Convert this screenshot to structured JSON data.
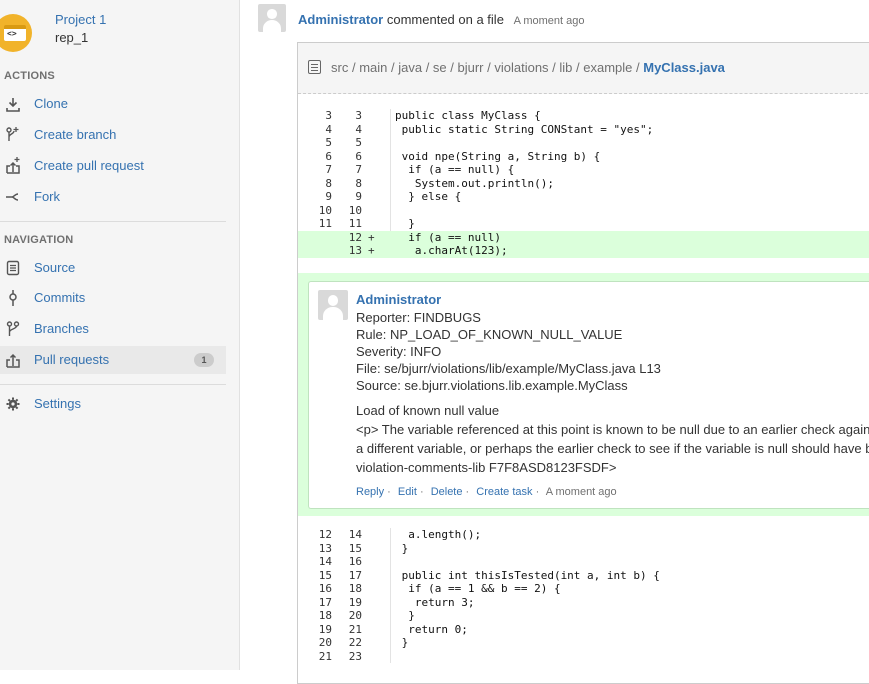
{
  "sidebar": {
    "project_name": "Project 1",
    "repo_name": "rep_1",
    "avatar_code": "<>",
    "actions_title": "ACTIONS",
    "actions": [
      {
        "label": "Clone",
        "icon": "download-icon"
      },
      {
        "label": "Create branch",
        "icon": "branch-add-icon"
      },
      {
        "label": "Create pull request",
        "icon": "pull-request-add-icon"
      },
      {
        "label": "Fork",
        "icon": "fork-icon"
      }
    ],
    "navigation_title": "NAVIGATION",
    "navigation": [
      {
        "label": "Source",
        "icon": "source-icon"
      },
      {
        "label": "Commits",
        "icon": "commit-icon"
      },
      {
        "label": "Branches",
        "icon": "branch-icon"
      },
      {
        "label": "Pull requests",
        "icon": "pull-request-icon",
        "badge": "1"
      }
    ],
    "settings_label": "Settings"
  },
  "activity": {
    "author": "Administrator",
    "text": "commented on a file",
    "time": "A moment ago"
  },
  "file": {
    "path_parts": [
      "src",
      "main",
      "java",
      "se",
      "bjurr",
      "violations",
      "lib",
      "example"
    ],
    "file_name": "MyClass.java"
  },
  "code_top": [
    {
      "n1": "3",
      "n2": "3",
      "mk": "",
      "text": "public class MyClass {"
    },
    {
      "n1": "4",
      "n2": "4",
      "mk": "",
      "text": " public static String CONStant = \"yes\";"
    },
    {
      "n1": "5",
      "n2": "5",
      "mk": "",
      "text": ""
    },
    {
      "n1": "6",
      "n2": "6",
      "mk": "",
      "text": " void npe(String a, String b) {"
    },
    {
      "n1": "7",
      "n2": "7",
      "mk": "",
      "text": "  if (a == null) {"
    },
    {
      "n1": "8",
      "n2": "8",
      "mk": "",
      "text": "   System.out.println();"
    },
    {
      "n1": "9",
      "n2": "9",
      "mk": "",
      "text": "  } else {"
    },
    {
      "n1": "10",
      "n2": "10",
      "mk": "",
      "text": ""
    },
    {
      "n1": "11",
      "n2": "11",
      "mk": "",
      "text": "  }"
    },
    {
      "n1": "",
      "n2": "12",
      "mk": "+",
      "text": "  if (a == null)",
      "added": true
    },
    {
      "n1": "",
      "n2": "13",
      "mk": "+",
      "text": "   a.charAt(123);",
      "added": true
    }
  ],
  "comment": {
    "author": "Administrator",
    "lines": [
      "Reporter: FINDBUGS",
      "Rule: NP_LOAD_OF_KNOWN_NULL_VALUE",
      "Severity: INFO",
      "File: se/bjurr/violations/lib/example/MyClass.java L13",
      "Source: se.bjurr.violations.lib.example.MyClass"
    ],
    "body": [
      "Load of known null value",
      "<p> The variable referenced at this point is known to be null due to an earlier check against n",
      "a different variable, or perhaps the earlier check to see if the variable is null should have bee",
      "violation-comments-lib F7F8ASD8123FSDF>"
    ],
    "actions": [
      "Reply",
      "Edit",
      "Delete",
      "Create task",
      "A moment ago"
    ]
  },
  "code_bottom": [
    {
      "n1": "12",
      "n2": "14",
      "mk": "",
      "text": "  a.length();"
    },
    {
      "n1": "13",
      "n2": "15",
      "mk": "",
      "text": " }"
    },
    {
      "n1": "14",
      "n2": "16",
      "mk": "",
      "text": ""
    },
    {
      "n1": "15",
      "n2": "17",
      "mk": "",
      "text": " public int thisIsTested(int a, int b) {"
    },
    {
      "n1": "16",
      "n2": "18",
      "mk": "",
      "text": "  if (a == 1 && b == 2) {"
    },
    {
      "n1": "17",
      "n2": "19",
      "mk": "",
      "text": "   return 3;"
    },
    {
      "n1": "18",
      "n2": "20",
      "mk": "",
      "text": "  }"
    },
    {
      "n1": "19",
      "n2": "21",
      "mk": "",
      "text": "  return 0;"
    },
    {
      "n1": "20",
      "n2": "22",
      "mk": "",
      "text": " }"
    },
    {
      "n1": "21",
      "n2": "23",
      "mk": "",
      "text": ""
    }
  ],
  "colors": {
    "link": "#3572b0",
    "added_bg": "#dbffdb",
    "avatar": "#f1b32a"
  }
}
